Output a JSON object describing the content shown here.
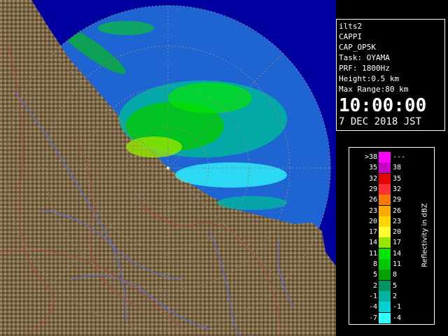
{
  "info": {
    "lines": [
      "ilts2",
      "CAPPI",
      "CAP_OP5K",
      "Task: OYAMA",
      "PRF: 1800Hz",
      "Height:0.5 km",
      "Max Range:80 km"
    ],
    "time": "10:00:00",
    "date": "7 DEC 2018 JST"
  },
  "legend": {
    "unit": "Reflectivity in dBZ",
    "rows": [
      {
        "lo": ">38",
        "hi": "---",
        "color": "#ff00ff"
      },
      {
        "lo": "35",
        "hi": "38",
        "color": "#c800c8"
      },
      {
        "lo": "32",
        "hi": "35",
        "color": "#e60000"
      },
      {
        "lo": "29",
        "hi": "32",
        "color": "#ff3232"
      },
      {
        "lo": "26",
        "hi": "29",
        "color": "#ff7800"
      },
      {
        "lo": "23",
        "hi": "26",
        "color": "#ffaa00"
      },
      {
        "lo": "20",
        "hi": "23",
        "color": "#ffd700"
      },
      {
        "lo": "17",
        "hi": "20",
        "color": "#ffff32"
      },
      {
        "lo": "14",
        "hi": "17",
        "color": "#96e600"
      },
      {
        "lo": "11",
        "hi": "14",
        "color": "#00e600"
      },
      {
        "lo": "8",
        "hi": "11",
        "color": "#00c800"
      },
      {
        "lo": "5",
        "hi": "8",
        "color": "#00a000"
      },
      {
        "lo": "2",
        "hi": "5",
        "color": "#009664"
      },
      {
        "lo": "-1",
        "hi": "2",
        "color": "#00b4a0"
      },
      {
        "lo": "-4",
        "hi": "-1",
        "color": "#00d2d2"
      },
      {
        "lo": "-7",
        "hi": "-4",
        "color": "#32ffff"
      }
    ]
  },
  "colors": {
    "sea": "#1e64d2",
    "outer_sea": "#0000a0",
    "land": "#8a7452",
    "river": "#5a6ad0",
    "border": "#b04848"
  }
}
